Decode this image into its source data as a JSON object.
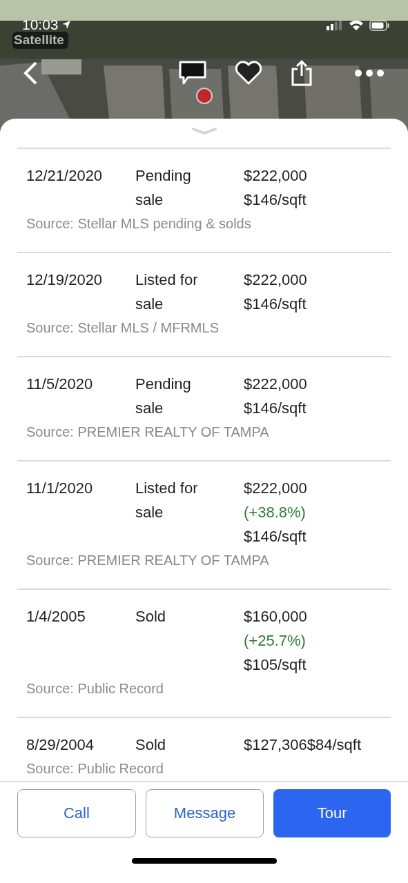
{
  "status_bar": {
    "time": "10:03",
    "map_mode": "Satellite"
  },
  "history": [
    {
      "date": "12/21/2020",
      "event": "Pending sale",
      "prices": [
        {
          "text": "$222,000",
          "kind": "plain"
        },
        {
          "text": "$146/sqft",
          "kind": "plain"
        }
      ],
      "source": "Source: Stellar MLS pending & solds"
    },
    {
      "date": "12/19/2020",
      "event": "Listed for sale",
      "prices": [
        {
          "text": "$222,000",
          "kind": "plain"
        },
        {
          "text": "$146/sqft",
          "kind": "plain"
        }
      ],
      "source": "Source: Stellar MLS / MFRMLS"
    },
    {
      "date": "11/5/2020",
      "event": "Pending sale",
      "prices": [
        {
          "text": "$222,000",
          "kind": "plain"
        },
        {
          "text": "$146/sqft",
          "kind": "plain"
        }
      ],
      "source": "Source: PREMIER REALTY OF TAMPA"
    },
    {
      "date": "11/1/2020",
      "event": "Listed for sale",
      "prices": [
        {
          "text": "$222,000",
          "kind": "plain"
        },
        {
          "text": "(+38.8%)",
          "kind": "change"
        },
        {
          "text": "$146/sqft",
          "kind": "plain"
        }
      ],
      "source": "Source: PREMIER REALTY OF TAMPA"
    },
    {
      "date": "1/4/2005",
      "event": "Sold",
      "prices": [
        {
          "text": "$160,000",
          "kind": "plain"
        },
        {
          "text": "(+25.7%)",
          "kind": "change"
        },
        {
          "text": "$105/sqft",
          "kind": "plain"
        }
      ],
      "source": "Source: Public Record"
    },
    {
      "date": "8/29/2004",
      "event": "Sold",
      "prices": [
        {
          "text": "$127,306$84/sqft",
          "kind": "plain"
        }
      ],
      "source": "Source: Public Record"
    }
  ],
  "actions": [
    {
      "label": "Call",
      "kind": "outline"
    },
    {
      "label": "Message",
      "kind": "outline"
    },
    {
      "label": "Tour",
      "kind": "primary"
    }
  ]
}
